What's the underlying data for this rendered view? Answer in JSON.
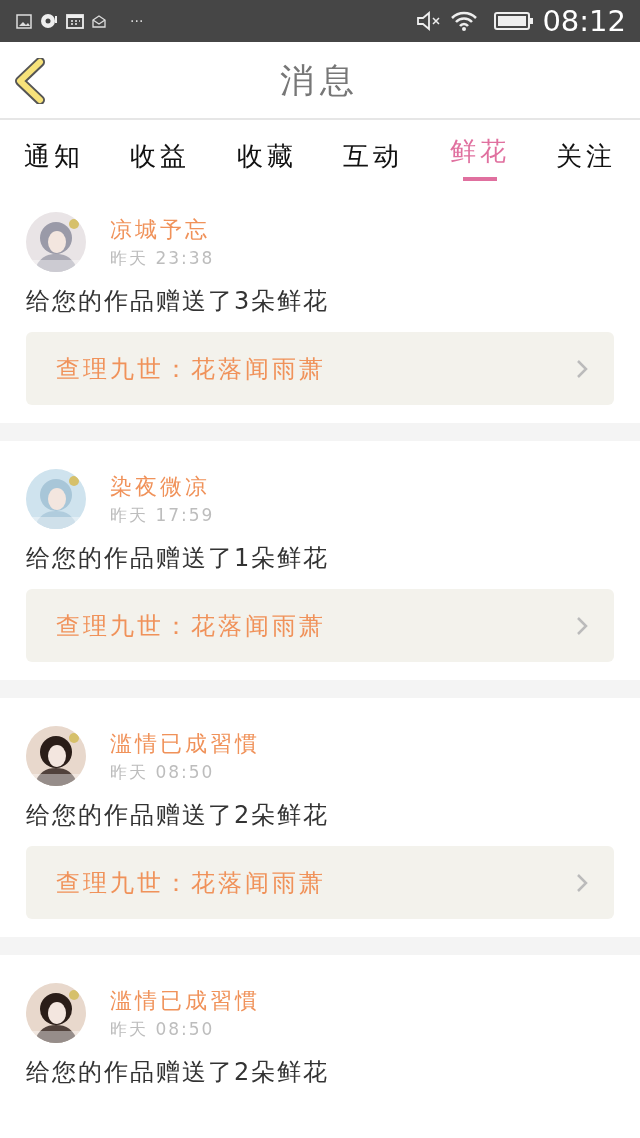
{
  "status_bar": {
    "time": "08:12",
    "overflow": "···"
  },
  "header": {
    "title": "消息"
  },
  "tabs": [
    {
      "label": "通知",
      "selected": false
    },
    {
      "label": "收益",
      "selected": false
    },
    {
      "label": "收藏",
      "selected": false
    },
    {
      "label": "互动",
      "selected": false
    },
    {
      "label": "鲜花",
      "selected": true
    },
    {
      "label": "关注",
      "selected": false
    }
  ],
  "messages": [
    {
      "user": "凉城予忘",
      "time": "昨天 23:38",
      "text": "给您的作品赠送了3朵鲜花",
      "work": "查理九世：花落闻雨萧"
    },
    {
      "user": "染夜微凉",
      "time": "昨天 17:59",
      "text": "给您的作品赠送了1朵鲜花",
      "work": "查理九世：花落闻雨萧"
    },
    {
      "user": "滥情已成習慣",
      "time": "昨天 08:50",
      "text": "给您的作品赠送了2朵鲜花",
      "work": "查理九世：花落闻雨萧"
    },
    {
      "user": "滥情已成習慣",
      "time": "昨天 08:50",
      "text": "给您的作品赠送了2朵鲜花"
    }
  ]
}
